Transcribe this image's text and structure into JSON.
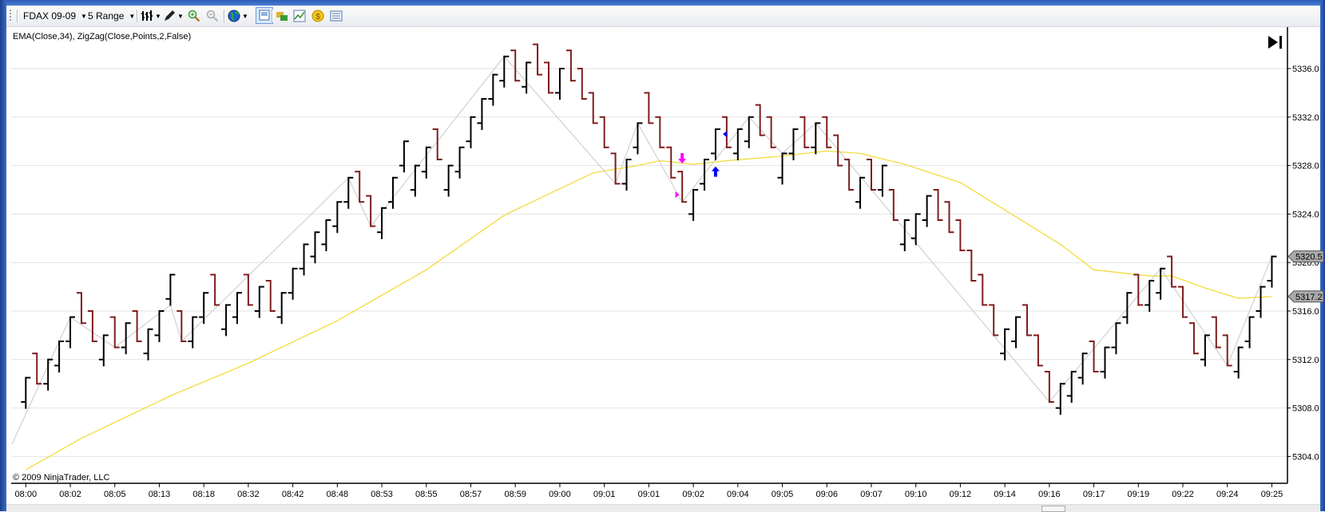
{
  "toolbar": {
    "instrument": "FDAX 09-09",
    "period": "5 Range",
    "icons": [
      "bar-style-icon",
      "drawing-pencil-icon",
      "zoom-in-icon",
      "zoom-out-icon",
      "globe-icon",
      "properties-icon",
      "instrument-swap-icon",
      "chart-icon",
      "currency-icon",
      "data-box-icon"
    ]
  },
  "chart": {
    "indicator_label": "EMA(Close,34), ZigZag(Close,Points,2,False)",
    "copyright": "© 2009 NinjaTrader, LLC",
    "colors": {
      "up": "#000000",
      "down": "#7f1d1d",
      "ema": "#f2dc3c",
      "zigzag": "#c8c8c8",
      "grid": "#e2e2e2",
      "sell": "#ff00ff",
      "buy": "#0000ff"
    }
  },
  "chart_data": {
    "type": "ohlc-bar",
    "title": "FDAX 09-09 5 Range",
    "y_ticks": [
      "5304.0",
      "5308.0",
      "5312.0",
      "5316.0",
      "5320.0",
      "5324.0",
      "5328.0",
      "5332.0",
      "5336.0"
    ],
    "y_tick_values": [
      5304,
      5308,
      5312,
      5316,
      5320,
      5324,
      5328,
      5332,
      5336
    ],
    "ylim": [
      5301.9,
      5339.6
    ],
    "x_tick_labels": [
      "08:00",
      "08:02",
      "08:05",
      "08:13",
      "08:18",
      "08:32",
      "08:42",
      "08:48",
      "08:53",
      "08:55",
      "08:57",
      "08:59",
      "09:00",
      "09:01",
      "09:01",
      "09:02",
      "09:04",
      "09:05",
      "09:06",
      "09:07",
      "09:10",
      "09:12",
      "09:14",
      "09:16",
      "09:17",
      "09:19",
      "09:22",
      "09:24",
      "09:25"
    ],
    "x_tick_every_bars": 4,
    "bars_format": "[high, low, direction(1=up,-1=down)]",
    "bars": [
      [
        5310.5,
        5308,
        1
      ],
      [
        5312.5,
        5310,
        -1
      ],
      [
        5312,
        5309.5,
        1
      ],
      [
        5313.5,
        5311,
        1
      ],
      [
        5315.5,
        5313,
        1
      ],
      [
        5317.5,
        5315,
        -1
      ],
      [
        5316,
        5313.5,
        -1
      ],
      [
        5314,
        5311.5,
        1
      ],
      [
        5315.5,
        5313,
        -1
      ],
      [
        5315,
        5312.5,
        1
      ],
      [
        5316,
        5313.5,
        -1
      ],
      [
        5314.5,
        5312,
        1
      ],
      [
        5316,
        5313.5,
        1
      ],
      [
        5319,
        5316.5,
        1
      ],
      [
        5316,
        5313.5,
        -1
      ],
      [
        5315.5,
        5313,
        1
      ],
      [
        5317.5,
        5315,
        1
      ],
      [
        5319,
        5316.5,
        -1
      ],
      [
        5316.5,
        5314,
        1
      ],
      [
        5317.5,
        5315,
        1
      ],
      [
        5319,
        5316.5,
        -1
      ],
      [
        5318,
        5315.5,
        1
      ],
      [
        5318.5,
        5316,
        -1
      ],
      [
        5317.5,
        5315,
        1
      ],
      [
        5319.5,
        5317,
        1
      ],
      [
        5321.5,
        5319,
        1
      ],
      [
        5322.5,
        5320,
        1
      ],
      [
        5323.5,
        5321,
        1
      ],
      [
        5325,
        5322.5,
        1
      ],
      [
        5327,
        5324.5,
        1
      ],
      [
        5327.5,
        5325,
        -1
      ],
      [
        5325.5,
        5323,
        -1
      ],
      [
        5324.5,
        5322,
        1
      ],
      [
        5327,
        5324.5,
        1
      ],
      [
        5330,
        5327.5,
        1
      ],
      [
        5328,
        5325.5,
        1
      ],
      [
        5329.5,
        5327,
        1
      ],
      [
        5331,
        5328.5,
        -1
      ],
      [
        5328,
        5325.5,
        1
      ],
      [
        5329.5,
        5327,
        1
      ],
      [
        5332,
        5329.5,
        1
      ],
      [
        5333.5,
        5331,
        1
      ],
      [
        5335.5,
        5333,
        1
      ],
      [
        5337,
        5334.5,
        1
      ],
      [
        5337.5,
        5335,
        -1
      ],
      [
        5336.5,
        5334,
        1
      ],
      [
        5338,
        5335.5,
        -1
      ],
      [
        5336.5,
        5334,
        -1
      ],
      [
        5336,
        5333.5,
        1
      ],
      [
        5337.5,
        5335,
        -1
      ],
      [
        5336,
        5333.5,
        -1
      ],
      [
        5334,
        5331.5,
        -1
      ],
      [
        5332,
        5329.5,
        -1
      ],
      [
        5329,
        5326.5,
        -1
      ],
      [
        5328.5,
        5326,
        1
      ],
      [
        5331.5,
        5329,
        1
      ],
      [
        5334,
        5331.5,
        -1
      ],
      [
        5332,
        5329.5,
        -1
      ],
      [
        5329.5,
        5327,
        -1
      ],
      [
        5327.5,
        5325,
        -1
      ],
      [
        5326,
        5323.5,
        1
      ],
      [
        5328.5,
        5326,
        1
      ],
      [
        5331,
        5328.5,
        1
      ],
      [
        5332,
        5329.5,
        -1
      ],
      [
        5331,
        5328.5,
        1
      ],
      [
        5332,
        5329.5,
        1
      ],
      [
        5333,
        5330.5,
        -1
      ],
      [
        5332,
        5329.5,
        -1
      ],
      [
        5329,
        5326.5,
        1
      ],
      [
        5331,
        5328.5,
        1
      ],
      [
        5332,
        5329.5,
        -1
      ],
      [
        5331.5,
        5329,
        1
      ],
      [
        5332,
        5329.5,
        -1
      ],
      [
        5330.5,
        5328,
        -1
      ],
      [
        5328.5,
        5326,
        -1
      ],
      [
        5327,
        5324.5,
        1
      ],
      [
        5328.5,
        5326,
        -1
      ],
      [
        5328,
        5325.5,
        1
      ],
      [
        5326,
        5323.5,
        -1
      ],
      [
        5323.5,
        5321,
        1
      ],
      [
        5324,
        5321.5,
        1
      ],
      [
        5325.5,
        5323,
        1
      ],
      [
        5326,
        5323.5,
        -1
      ],
      [
        5325,
        5322.5,
        -1
      ],
      [
        5323.5,
        5321,
        -1
      ],
      [
        5321,
        5318.5,
        -1
      ],
      [
        5319,
        5316.5,
        -1
      ],
      [
        5316.5,
        5314,
        -1
      ],
      [
        5314.5,
        5312,
        1
      ],
      [
        5315.5,
        5313,
        1
      ],
      [
        5316.5,
        5314,
        -1
      ],
      [
        5314,
        5311.5,
        -1
      ],
      [
        5311,
        5308.5,
        -1
      ],
      [
        5310,
        5307.5,
        1
      ],
      [
        5311,
        5308.5,
        1
      ],
      [
        5312.5,
        5310,
        1
      ],
      [
        5313.5,
        5311,
        -1
      ],
      [
        5313,
        5310.5,
        1
      ],
      [
        5315,
        5312.5,
        1
      ],
      [
        5317.5,
        5315,
        1
      ],
      [
        5319,
        5316.5,
        -1
      ],
      [
        5318.5,
        5316,
        1
      ],
      [
        5319.5,
        5317,
        1
      ],
      [
        5320.5,
        5318,
        -1
      ],
      [
        5318,
        5315.5,
        -1
      ],
      [
        5315,
        5312.5,
        -1
      ],
      [
        5314,
        5311.5,
        1
      ],
      [
        5315.5,
        5313,
        -1
      ],
      [
        5314,
        5311.5,
        -1
      ],
      [
        5313,
        5310.5,
        1
      ],
      [
        5315.5,
        5313,
        1
      ],
      [
        5318,
        5315.5,
        1
      ],
      [
        5320.5,
        5318,
        1
      ]
    ],
    "ema_series": {
      "name": "EMA(Close,34)",
      "points": [
        [
          0,
          5302.9
        ],
        [
          5,
          5305.5
        ],
        [
          13,
          5309.0
        ],
        [
          20,
          5311.7
        ],
        [
          28,
          5315.2
        ],
        [
          36,
          5319.4
        ],
        [
          43,
          5323.9
        ],
        [
          51,
          5327.4
        ],
        [
          55,
          5328.0
        ],
        [
          57,
          5328.4
        ],
        [
          60,
          5328.1
        ],
        [
          63,
          5328.4
        ],
        [
          67,
          5328.7
        ],
        [
          72,
          5329.2
        ],
        [
          75,
          5329.0
        ],
        [
          79,
          5328.1
        ],
        [
          84,
          5326.6
        ],
        [
          90,
          5323.2
        ],
        [
          93,
          5321.5
        ],
        [
          96,
          5319.4
        ],
        [
          101,
          5318.9
        ],
        [
          103,
          5318.9
        ],
        [
          106,
          5317.9
        ],
        [
          109,
          5317.05
        ],
        [
          112,
          5317.2
        ]
      ]
    },
    "zigzag_series": {
      "name": "ZigZag(Close,Points,2,False)",
      "points": [
        [
          -1.25,
          5305
        ],
        [
          4,
          5315.5
        ],
        [
          8,
          5313
        ],
        [
          13,
          5316.5
        ],
        [
          14,
          5313.5
        ],
        [
          29,
          5327
        ],
        [
          31,
          5323
        ],
        [
          43,
          5337
        ],
        [
          53,
          5326.5
        ],
        [
          55,
          5331.5
        ],
        [
          59,
          5325
        ],
        [
          65,
          5332
        ],
        [
          68,
          5329
        ],
        [
          71,
          5331.5
        ],
        [
          92,
          5308.5
        ],
        [
          102,
          5319.5
        ],
        [
          108,
          5311.5
        ],
        [
          112,
          5320.5
        ]
      ]
    },
    "markers": [
      {
        "kind": "arrow-down",
        "bar": 59,
        "price": 5328.5,
        "color": "#ff00ff"
      },
      {
        "kind": "triangle-right",
        "bar": 58.6,
        "price": 5325.6,
        "color": "#ff00ff"
      },
      {
        "kind": "arrow-up",
        "bar": 62,
        "price": 5327.6,
        "color": "#0000ff"
      },
      {
        "kind": "triangle-left",
        "bar": 62.8,
        "price": 5330.6,
        "color": "#0000ff"
      }
    ],
    "price_tags": [
      {
        "label": "5320.5",
        "price": 5320.5
      },
      {
        "label": "5317.2",
        "price": 5317.2
      }
    ]
  }
}
